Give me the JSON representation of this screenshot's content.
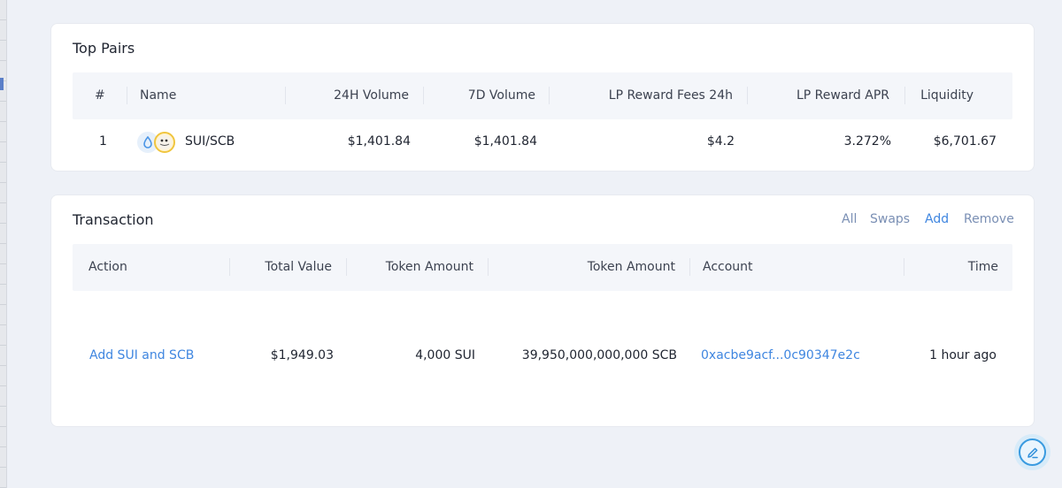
{
  "top_pairs": {
    "title": "Top Pairs",
    "columns": [
      "#",
      "Name",
      "24H Volume",
      "7D Volume",
      "LP Reward Fees 24h",
      "LP Reward APR",
      "Liquidity"
    ],
    "rows": [
      {
        "rank": "1",
        "name": "SUI/SCB",
        "volume_24h": "$1,401.84",
        "volume_7d": "$1,401.84",
        "lp_fees_24h": "$4.2",
        "lp_apr": "3.272%",
        "liquidity": "$6,701.67",
        "icons": [
          "sui-token-icon",
          "scb-token-icon"
        ]
      }
    ]
  },
  "transaction": {
    "title": "Transaction",
    "filters": [
      {
        "label": "All",
        "active": false
      },
      {
        "label": "Swaps",
        "active": false
      },
      {
        "label": "Add",
        "active": true
      },
      {
        "label": "Remove",
        "active": false
      }
    ],
    "columns": [
      "Action",
      "Total Value",
      "Token Amount",
      "Token Amount",
      "Account",
      "Time"
    ],
    "rows": [
      {
        "action": "Add SUI and SCB",
        "total_value": "$1,949.03",
        "token_amount_a": "4,000 SUI",
        "token_amount_b": "39,950,000,000,000 SCB",
        "account": "0xacbe9acf...0c90347e2c",
        "time": "1 hour ago"
      }
    ]
  },
  "colors": {
    "link": "#3f86e0",
    "filter_inactive": "#7a8fb4",
    "background": "#eef1f7",
    "card": "#ffffff",
    "table_header": "#f4f6fa"
  },
  "floating_button": {
    "icon": "edit-pen-icon"
  }
}
